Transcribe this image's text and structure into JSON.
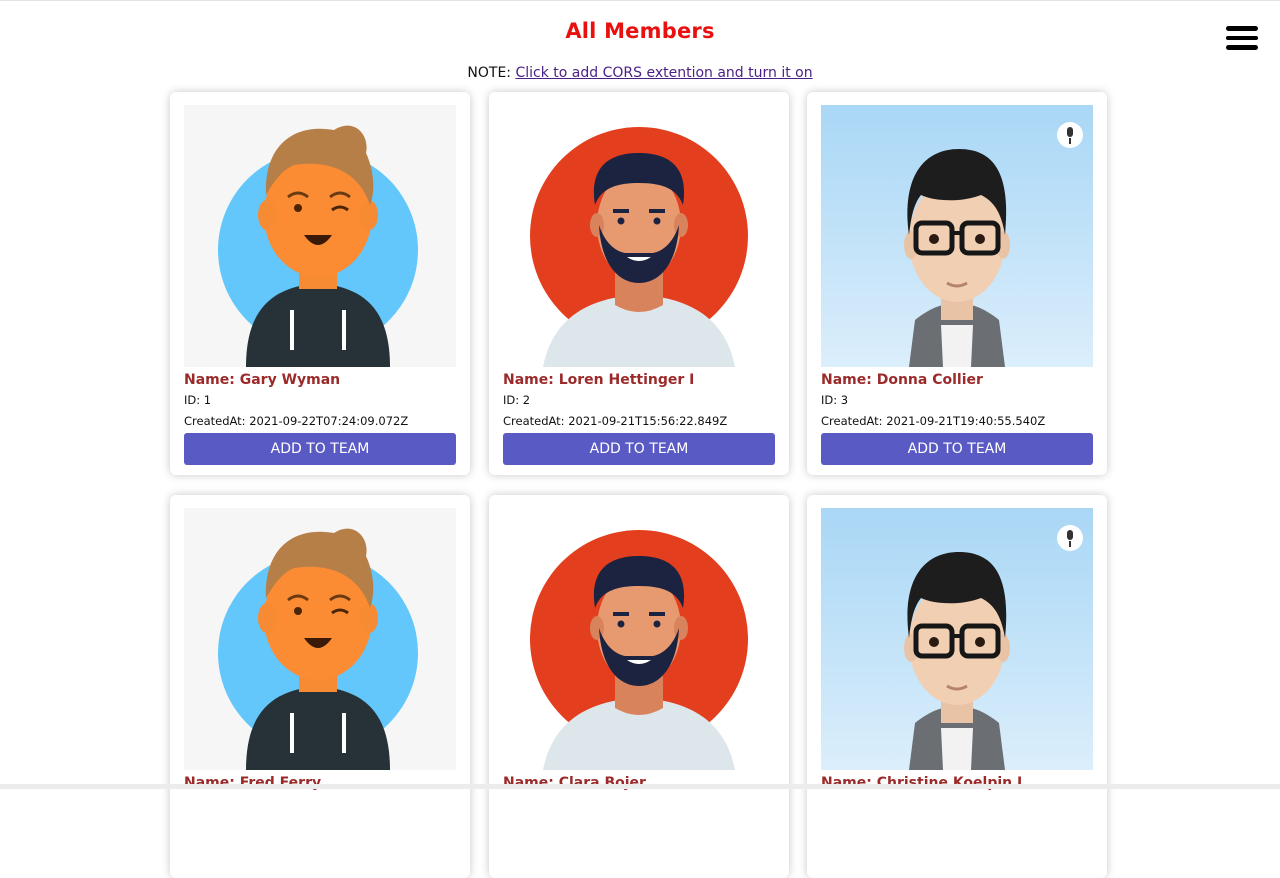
{
  "header": {
    "title": "All Members",
    "menu_icon": "hamburger-menu-icon"
  },
  "note": {
    "prefix": "NOTE: ",
    "link_text": "Click to add CORS extention and turn it on"
  },
  "colors": {
    "title": "#e8110f",
    "name_text": "#9b2a2a",
    "button_bg": "#5a5ac4",
    "link": "#4b1f86"
  },
  "members": [
    {
      "name": "Name: Gary Wyman",
      "id": "ID: 1",
      "created": "CreatedAt: 2021-09-22T07:24:09.072Z",
      "button": "ADD TO TEAM",
      "avatar": "cartoon-boy-avatar"
    },
    {
      "name": "Name: Loren Hettinger I",
      "id": "ID: 2",
      "created": "CreatedAt: 2021-09-21T15:56:22.849Z",
      "button": "ADD TO TEAM",
      "avatar": "bearded-man-avatar"
    },
    {
      "name": "Name: Donna Collier",
      "id": "ID: 3",
      "created": "CreatedAt: 2021-09-21T19:40:55.540Z",
      "button": "ADD TO TEAM",
      "avatar": "glasses-man-avatar"
    },
    {
      "name": "Name: Fred Ferry",
      "id": "",
      "created": "",
      "button": "",
      "avatar": "cartoon-boy-avatar"
    },
    {
      "name": "Name: Clara Bojer",
      "id": "",
      "created": "",
      "button": "",
      "avatar": "bearded-man-avatar"
    },
    {
      "name": "Name: Christine Koelpin I",
      "id": "",
      "created": "",
      "button": "",
      "avatar": "glasses-man-avatar"
    }
  ]
}
